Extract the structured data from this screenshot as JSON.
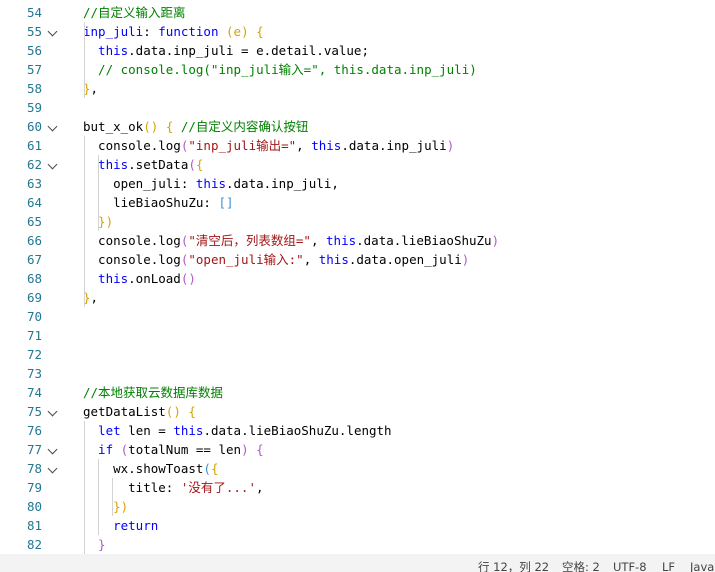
{
  "colors": {
    "comment": "#008000",
    "keyword": "#0000ff",
    "string": "#a31515",
    "this": "#0000ff",
    "plain": "#000000",
    "bracket_gold": "#d6a300",
    "bracket_purple": "#b05ac8",
    "bracket_blue": "#3c8fd0",
    "gutter": "#237893"
  },
  "editor": {
    "lines": [
      {
        "n": "54",
        "fold": false,
        "tokens": [
          [
            "c",
            "//自定义输入距离"
          ]
        ]
      },
      {
        "n": "55",
        "fold": true,
        "tokens": [
          [
            "k",
            "inp_juli"
          ],
          [
            "p",
            ": "
          ],
          [
            "k",
            "function"
          ],
          [
            "p",
            " "
          ],
          [
            "b2",
            "(e)"
          ],
          [
            "p",
            " "
          ],
          [
            "b2",
            "{"
          ]
        ]
      },
      {
        "n": "56",
        "fold": false,
        "tokens": [
          [
            "t",
            "  this"
          ],
          [
            "p",
            ".data.inp_juli = e.detail.value;"
          ]
        ]
      },
      {
        "n": "57",
        "fold": false,
        "tokens": [
          [
            "c",
            "  // console.log(\"inp_juli输入=\", this.data.inp_juli)"
          ]
        ]
      },
      {
        "n": "58",
        "fold": false,
        "tokens": [
          [
            "b2",
            "}"
          ],
          [
            "p",
            ","
          ]
        ]
      },
      {
        "n": "59",
        "fold": false,
        "tokens": []
      },
      {
        "n": "60",
        "fold": true,
        "tokens": [
          [
            "p",
            "but_x_ok"
          ],
          [
            "b2",
            "()"
          ],
          [
            "p",
            " "
          ],
          [
            "b2",
            "{"
          ],
          [
            "p",
            " "
          ],
          [
            "c",
            "//自定义内容确认按钮"
          ]
        ]
      },
      {
        "n": "61",
        "fold": false,
        "tokens": [
          [
            "p",
            "  console.log"
          ],
          [
            "b3",
            "("
          ],
          [
            "s",
            "\"inp_juli输出=\""
          ],
          [
            "p",
            ", "
          ],
          [
            "t",
            "this"
          ],
          [
            "p",
            ".data.inp_juli"
          ],
          [
            "b3",
            ")"
          ]
        ]
      },
      {
        "n": "62",
        "fold": true,
        "tokens": [
          [
            "t",
            "  this"
          ],
          [
            "p",
            ".setData"
          ],
          [
            "b3",
            "("
          ],
          [
            "b2",
            "{"
          ]
        ]
      },
      {
        "n": "63",
        "fold": false,
        "tokens": [
          [
            "p",
            "    open_juli: "
          ],
          [
            "t",
            "this"
          ],
          [
            "p",
            ".data.inp_juli,"
          ]
        ]
      },
      {
        "n": "64",
        "fold": false,
        "tokens": [
          [
            "p",
            "    lieBiaoShuZu: "
          ],
          [
            "b1",
            "[]"
          ]
        ]
      },
      {
        "n": "65",
        "fold": false,
        "tokens": [
          [
            "b2",
            "  })"
          ]
        ]
      },
      {
        "n": "66",
        "fold": false,
        "tokens": [
          [
            "p",
            "  console.log"
          ],
          [
            "b3",
            "("
          ],
          [
            "s",
            "\"清空后，列表数组=\""
          ],
          [
            "p",
            ", "
          ],
          [
            "t",
            "this"
          ],
          [
            "p",
            ".data.lieBiaoShuZu"
          ],
          [
            "b3",
            ")"
          ]
        ]
      },
      {
        "n": "67",
        "fold": false,
        "tokens": [
          [
            "p",
            "  console.log"
          ],
          [
            "b3",
            "("
          ],
          [
            "s",
            "\"open_juli输入:\""
          ],
          [
            "p",
            ", "
          ],
          [
            "t",
            "this"
          ],
          [
            "p",
            ".data.open_juli"
          ],
          [
            "b3",
            ")"
          ]
        ]
      },
      {
        "n": "68",
        "fold": false,
        "tokens": [
          [
            "t",
            "  this"
          ],
          [
            "p",
            ".onLoad"
          ],
          [
            "b3",
            "()"
          ]
        ]
      },
      {
        "n": "69",
        "fold": false,
        "tokens": [
          [
            "b2",
            "}"
          ],
          [
            "p",
            ","
          ]
        ]
      },
      {
        "n": "70",
        "fold": false,
        "tokens": []
      },
      {
        "n": "71",
        "fold": false,
        "tokens": []
      },
      {
        "n": "72",
        "fold": false,
        "tokens": []
      },
      {
        "n": "73",
        "fold": false,
        "tokens": []
      },
      {
        "n": "74",
        "fold": false,
        "tokens": [
          [
            "c",
            "//本地获取云数据库数据"
          ]
        ]
      },
      {
        "n": "75",
        "fold": true,
        "tokens": [
          [
            "p",
            "getDataList"
          ],
          [
            "b2",
            "()"
          ],
          [
            "p",
            " "
          ],
          [
            "b2",
            "{"
          ]
        ]
      },
      {
        "n": "76",
        "fold": false,
        "tokens": [
          [
            "k",
            "  let"
          ],
          [
            "p",
            " len = "
          ],
          [
            "t",
            "this"
          ],
          [
            "p",
            ".data.lieBiaoShuZu.length"
          ]
        ]
      },
      {
        "n": "77",
        "fold": true,
        "tokens": [
          [
            "k",
            "  if"
          ],
          [
            "p",
            " "
          ],
          [
            "b3",
            "("
          ],
          [
            "p",
            "totalNum == len"
          ],
          [
            "b3",
            ")"
          ],
          [
            "p",
            " "
          ],
          [
            "b3",
            "{"
          ]
        ]
      },
      {
        "n": "78",
        "fold": true,
        "tokens": [
          [
            "p",
            "    wx.showToast"
          ],
          [
            "b1",
            "("
          ],
          [
            "b2",
            "{"
          ]
        ]
      },
      {
        "n": "79",
        "fold": false,
        "tokens": [
          [
            "p",
            "      title: "
          ],
          [
            "s",
            "'没有了...'"
          ],
          [
            "p",
            ","
          ]
        ]
      },
      {
        "n": "80",
        "fold": false,
        "tokens": [
          [
            "b2",
            "    })"
          ]
        ]
      },
      {
        "n": "81",
        "fold": false,
        "tokens": [
          [
            "k",
            "    return"
          ]
        ]
      },
      {
        "n": "82",
        "fold": false,
        "tokens": [
          [
            "b3",
            "  }"
          ]
        ]
      }
    ]
  },
  "statusbar": {
    "position": "行 12，列 22",
    "spaces": "空格: 2",
    "encoding": "UTF-8",
    "eol": "LF",
    "language": "JavaScript"
  }
}
